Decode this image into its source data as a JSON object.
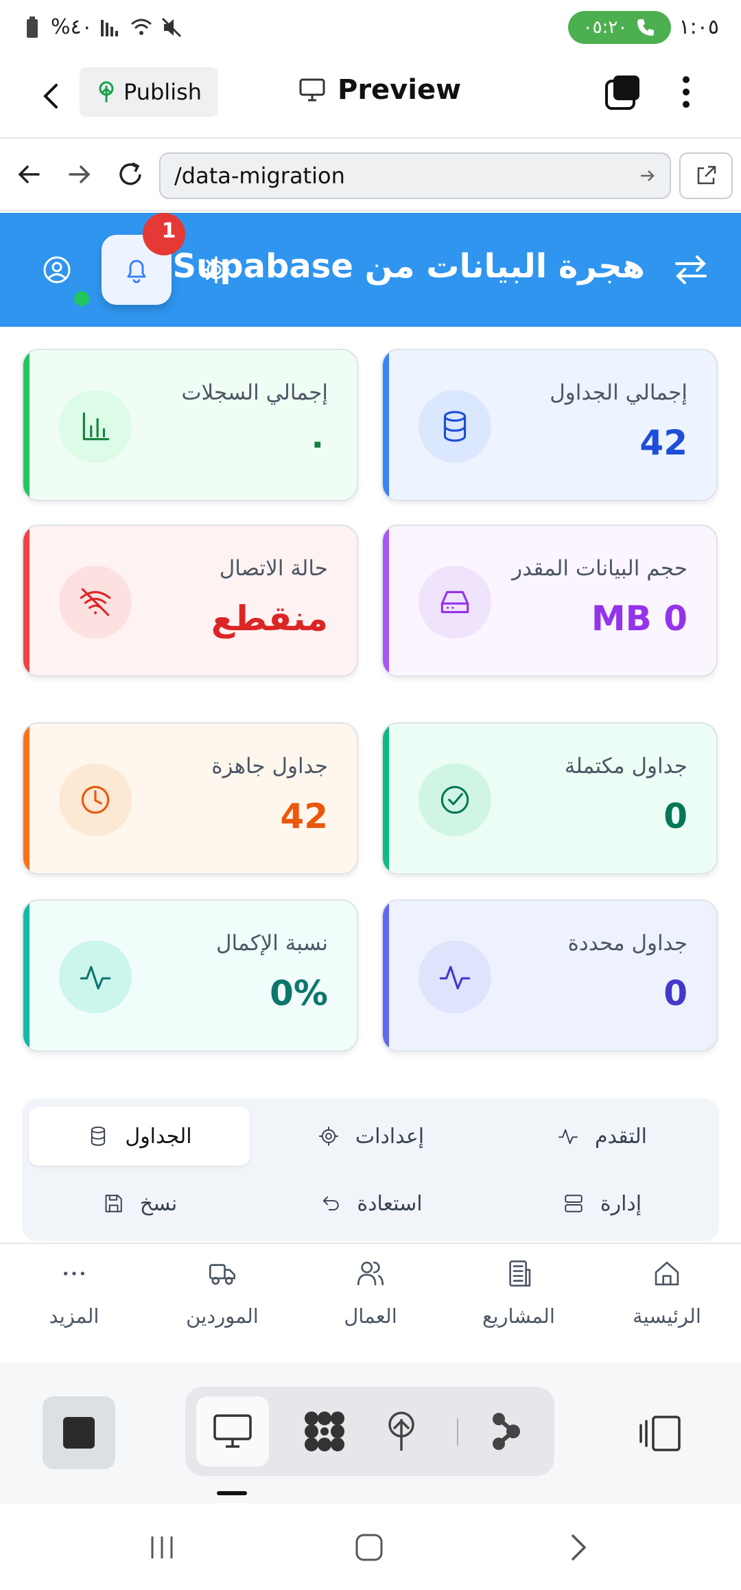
{
  "status": {
    "battery": "%٤٠",
    "call_time": "٠٥:٢٠",
    "clock": "١:٠٥"
  },
  "appbar": {
    "publish_label": "Publish",
    "preview_label": "Preview"
  },
  "browser": {
    "url": "/data-migration"
  },
  "hero": {
    "title": "هجرة البيانات من Supabase",
    "notification_count": "1"
  },
  "cards": [
    {
      "label": "إجمالي الجداول",
      "value": "42",
      "icon": "database-icon",
      "accent": "#3b82f6",
      "color": "#1d4ed8",
      "bg": "#eef4ff",
      "icon_bg": "#dbe7fd"
    },
    {
      "label": "إجمالي السجلات",
      "value": "٠",
      "icon": "bar-chart-icon",
      "accent": "#22c55e",
      "color": "#15803d",
      "bg": "#f0fdf4",
      "icon_bg": "#dcfce7"
    },
    {
      "label": "حجم البيانات المقدر",
      "value": "MB 0",
      "icon": "hard-drive-icon",
      "accent": "#a855f7",
      "color": "#9333ea",
      "bg": "#faf5ff",
      "icon_bg": "#f0e4fd"
    },
    {
      "label": "حالة الاتصال",
      "value": "منقطع",
      "icon": "wifi-off-icon",
      "accent": "#ef4444",
      "color": "#dc2626",
      "bg": "#fef2f2",
      "icon_bg": "#fde0e0"
    },
    {
      "label": "جداول مكتملة",
      "value": "0",
      "icon": "check-circle-icon",
      "accent": "#10b981",
      "color": "#047857",
      "bg": "#ecfdf5",
      "icon_bg": "#d1f5e4"
    },
    {
      "label": "جداول جاهزة",
      "value": "42",
      "icon": "clock-icon",
      "accent": "#f97316",
      "color": "#ea580c",
      "bg": "#fff7ed",
      "icon_bg": "#fde8d4"
    },
    {
      "label": "جداول محددة",
      "value": "0",
      "icon": "activity-icon",
      "accent": "#6366f1",
      "color": "#4338ca",
      "bg": "#eef2ff",
      "icon_bg": "#dfe3fc"
    },
    {
      "label": "نسبة الإكمال",
      "value": "0%",
      "icon": "activity-icon",
      "accent": "#14b8a6",
      "color": "#0f766e",
      "bg": "#f0fdfa",
      "icon_bg": "#ccf5ec"
    }
  ],
  "tabs": [
    {
      "label": "الجداول",
      "icon": "database-icon",
      "active": true
    },
    {
      "label": "إعدادات",
      "icon": "gear-icon",
      "active": false
    },
    {
      "label": "التقدم",
      "icon": "activity-icon",
      "active": false
    },
    {
      "label": "نسخ",
      "icon": "save-icon",
      "active": false
    },
    {
      "label": "استعادة",
      "icon": "undo-icon",
      "active": false
    },
    {
      "label": "إدارة",
      "icon": "server-icon",
      "active": false
    }
  ],
  "bottom_nav": [
    {
      "label": "الرئيسية",
      "icon": "home-icon"
    },
    {
      "label": "المشاريع",
      "icon": "building-icon"
    },
    {
      "label": "العمال",
      "icon": "users-icon"
    },
    {
      "label": "الموردين",
      "icon": "truck-icon"
    },
    {
      "label": "المزيد",
      "icon": "more-icon"
    }
  ]
}
